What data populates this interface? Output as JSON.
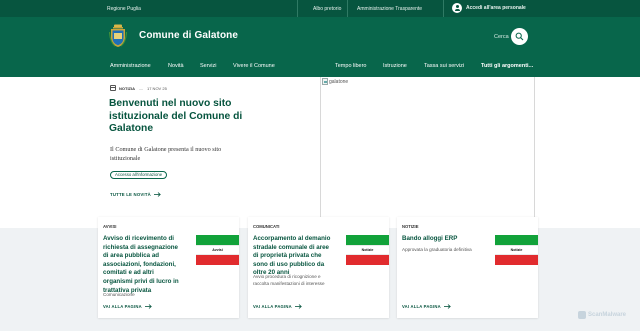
{
  "top_bar": {
    "region": "Regione Puglia",
    "links": [
      "Albo pretorio",
      "Amministrazione Trasparente"
    ],
    "login_label": "Accedi all'area personale"
  },
  "header": {
    "site_name": "Comune di Galatone",
    "search_label": "Cerca"
  },
  "nav": {
    "left_items": [
      "Amministrazione",
      "Novità",
      "Servizi",
      "Vivere il Comune"
    ],
    "right_items": [
      "Tempo libero",
      "Istruzione",
      "Tassa sui servizi"
    ],
    "all_topics": "Tutti gli argomenti..."
  },
  "hero": {
    "category": "Notizia",
    "date": "17 NOV 25",
    "title": "Benvenuti nel nuovo sito istituzionale del Comune di Galatone",
    "text": "Il Comune di Galatone presenta il nuovo sito istituzionale",
    "chip": "Accesso all'informazione",
    "all_news": "TUTTE LE NOVITÀ",
    "image_alt": "galatone"
  },
  "cards": [
    {
      "category": "Avvisi",
      "title": "Avviso di ricevimento di richiesta di assegnazione di area pubblica ad associazioni, fondazioni, comitati e ad altri organismi privi di lucro in trattativa privata",
      "meta": "Comunicazione",
      "flag_label": "Avvisi",
      "more": "VAI ALLA PAGINA"
    },
    {
      "category": "Comunicati",
      "title": "Accorpamento al demanio stradale comunale di aree di proprietà privata che sono di uso pubblico da oltre 20 anni",
      "desc": "Avvio procedura di ricognizione e raccolta manifestazioni di interesse",
      "flag_label": "Notizie",
      "more": "VAI ALLA PAGINA"
    },
    {
      "category": "Notizie",
      "title": "Bando alloggi ERP",
      "desc": "Approvata la graduatoria definitiva",
      "flag_label": "Notizie",
      "more": "VAI ALLA PAGINA"
    }
  ],
  "watermark": "ScanMalware",
  "colors": {
    "primary_dark": "#07553f",
    "primary": "#08664b",
    "flag_green": "#12a23a",
    "flag_red": "#e12b2e",
    "section_bg": "#eff2f4"
  },
  "icons": [
    "user-icon",
    "search-icon",
    "calendar-icon",
    "arrow-right-icon",
    "broken-image-icon",
    "crest-logo"
  ]
}
